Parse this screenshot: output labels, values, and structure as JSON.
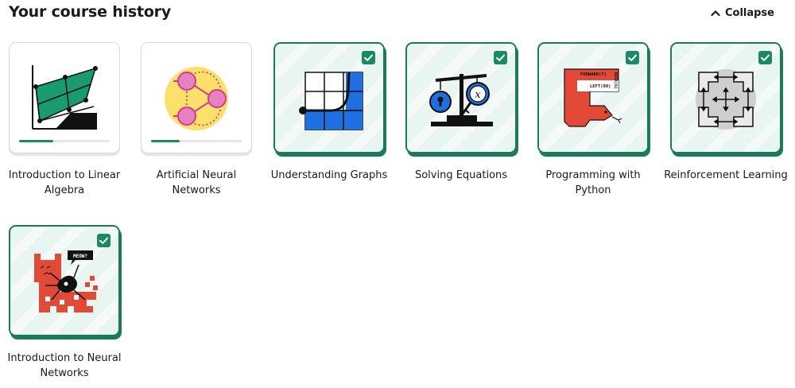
{
  "header": {
    "title": "Your course history",
    "collapse_label": "Collapse"
  },
  "courses": [
    {
      "title": "Introduction to Linear Algebra",
      "completed": false,
      "progress": 0.38,
      "icon": "linear-algebra-icon"
    },
    {
      "title": "Artificial Neural Networks",
      "completed": false,
      "progress": 0.32,
      "icon": "neural-network-icon"
    },
    {
      "title": "Understanding Graphs",
      "completed": true,
      "icon": "graph-curve-icon"
    },
    {
      "title": "Solving Equations",
      "completed": true,
      "icon": "balance-scale-icon"
    },
    {
      "title": "Programming with Python",
      "completed": true,
      "icon": "python-snake-icon"
    },
    {
      "title": "Reinforcement Learning",
      "completed": true,
      "icon": "maze-arrows-icon"
    },
    {
      "title": "Introduction to Neural Networks",
      "completed": true,
      "icon": "cat-neuron-icon"
    }
  ],
  "art_text": {
    "python_forward": "FORWARD(7)",
    "python_left": "LEFT(90)",
    "python_back": "BACK(6)",
    "meow": "MEOW?",
    "x_var": "x"
  },
  "colors": {
    "accent": "#1a8a66",
    "completed_border": "#1a7a5c",
    "completed_bg": "#e9f5f0"
  }
}
